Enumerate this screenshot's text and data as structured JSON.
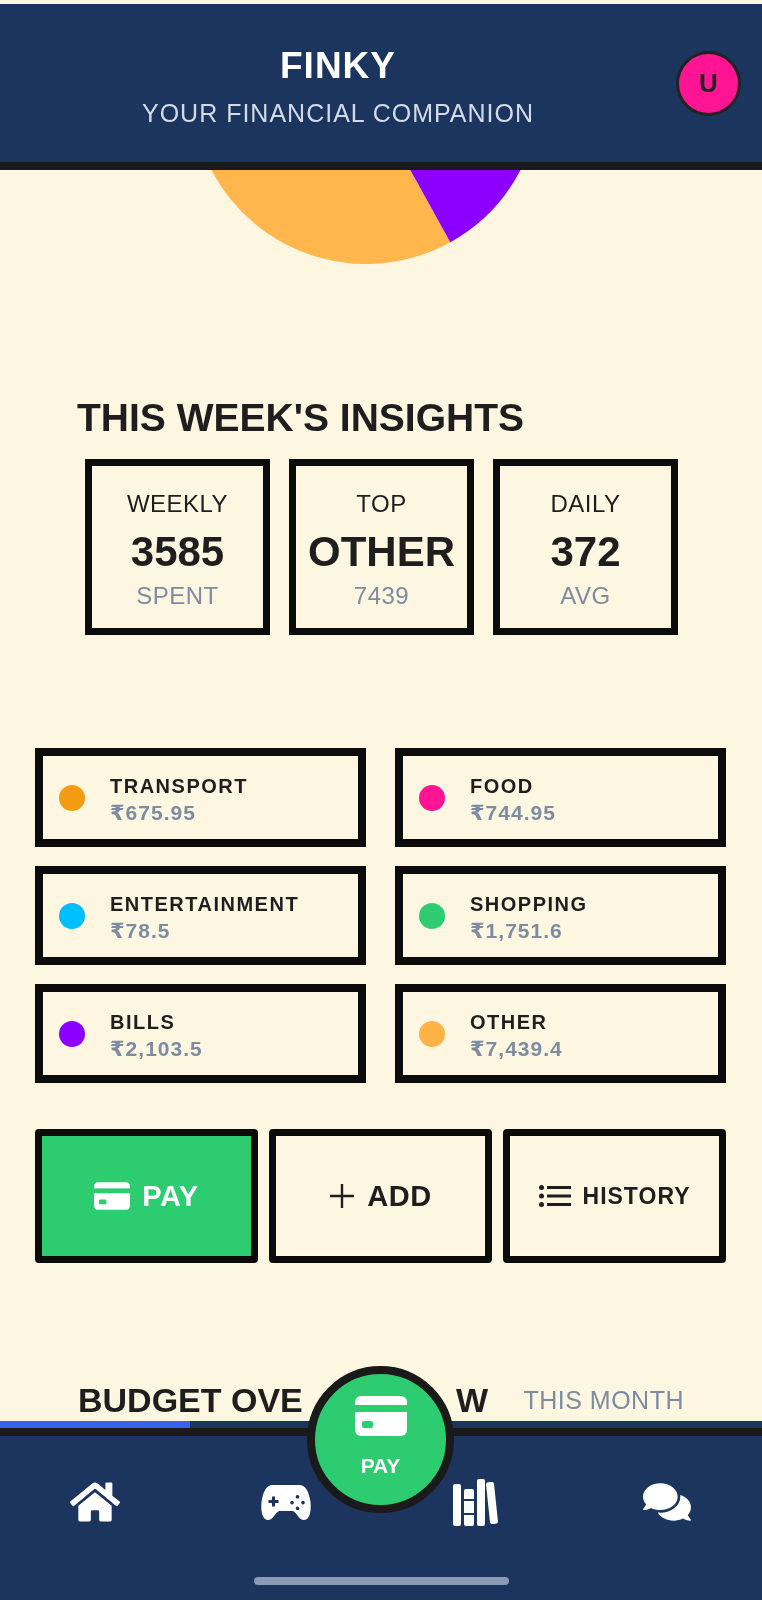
{
  "header": {
    "title": "FINKY",
    "subtitle": "YOUR FINANCIAL COMPANION",
    "avatar_initial": "U"
  },
  "insights": {
    "title": "THIS WEEK'S INSIGHTS",
    "cards": [
      {
        "label": "WEEKLY",
        "value": "3585",
        "caption": "SPENT"
      },
      {
        "label": "TOP",
        "value": "OTHER",
        "caption": "7439"
      },
      {
        "label": "DAILY",
        "value": "372",
        "caption": "AVG"
      }
    ]
  },
  "categories": [
    {
      "name": "TRANSPORT",
      "amount": "₹675.95",
      "color": "#f39c12"
    },
    {
      "name": "FOOD",
      "amount": "₹744.95",
      "color": "#ff1493"
    },
    {
      "name": "ENTERTAINMENT",
      "amount": "₹78.5",
      "color": "#00bfff"
    },
    {
      "name": "SHOPPING",
      "amount": "₹1,751.6",
      "color": "#2ecc71"
    },
    {
      "name": "BILLS",
      "amount": "₹2,103.5",
      "color": "#8b00ff"
    },
    {
      "name": "OTHER",
      "amount": "₹7,439.4",
      "color": "#ffb347"
    }
  ],
  "actions": [
    {
      "kind": "pay",
      "label": "PAY"
    },
    {
      "kind": "add",
      "label": "ADD"
    },
    {
      "kind": "history",
      "label": "HISTORY"
    }
  ],
  "budget": {
    "title_start": "BUDGET OVE",
    "title_end": "W",
    "period": "THIS MONTH"
  },
  "bottom_nav": {
    "items": [
      {
        "kind": "home"
      },
      {
        "kind": "games"
      },
      {
        "kind": "library"
      },
      {
        "kind": "chat"
      }
    ],
    "center_button": {
      "label": "PAY"
    }
  }
}
